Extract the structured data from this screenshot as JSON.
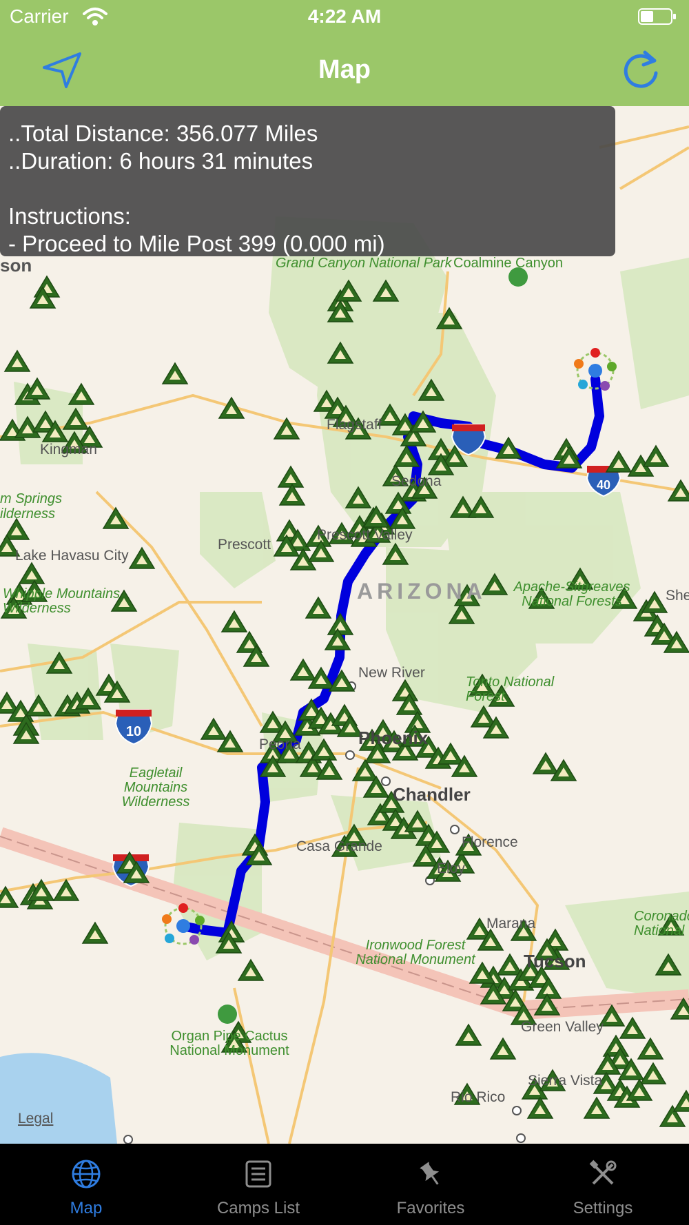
{
  "status_bar": {
    "carrier": "Carrier",
    "time": "4:22 AM"
  },
  "nav": {
    "title": "Map"
  },
  "info": {
    "total_distance": "..Total Distance: 356.077 Miles",
    "duration": "..Duration: 6 hours 31 minutes",
    "instructions_heading": "Instructions:",
    "instruction_1": "- Proceed to Mile Post 399 (0.000 mi)"
  },
  "map": {
    "labels": {
      "grand_canyon": "Grand Canyon National Park",
      "coalmine": "Coalmine Canyon",
      "kingman": "Kingman",
      "flagstaff": "Flagstaff",
      "sedona": "Sedona",
      "prescott": "Prescott",
      "prescott_valley": "Prescott Valley",
      "springs": "m Springs",
      "wilderness_left": "ilderness",
      "lake_havasu": "Lake Havasu City",
      "whipple": "Whipple Mountains Wilderness",
      "arizona": "ARIZONA",
      "apache": "Apache-Sitgreaves National Forests",
      "she": "She",
      "new_river": "New River",
      "tonto": "Tonto National Forest",
      "peoria": "Peoria",
      "phoenix": "Phoenix",
      "chandler": "Chandler",
      "eagletail": "Eagletail Mountains Wilderness",
      "casa_grande": "Casa Grande",
      "florence": "Florence",
      "eloy": "Eloy",
      "marana": "Marana",
      "tucson": "Tucson",
      "ironwood": "Ironwood Forest National Monument",
      "organ_pipe": "Organ Pipe Cactus National Monument",
      "green_valley": "Green Valley",
      "sierra_vista": "Sierra Vista",
      "rio_rico": "Rio Rico",
      "coronado": "Coronado National",
      "son": "son",
      "shield_i40": "40",
      "shield_i10": "10"
    },
    "legal": "Legal"
  },
  "tabs": [
    {
      "label": "Map",
      "icon": "globe-icon",
      "active": true
    },
    {
      "label": "Camps List",
      "icon": "list-icon",
      "active": false
    },
    {
      "label": "Favorites",
      "icon": "pin-icon",
      "active": false
    },
    {
      "label": "Settings",
      "icon": "tools-icon",
      "active": false
    }
  ],
  "colors": {
    "header": "#9bc769",
    "route": "#0000dd",
    "tab_active": "#2f7de1",
    "camp_marker": "#2d6b1e"
  }
}
